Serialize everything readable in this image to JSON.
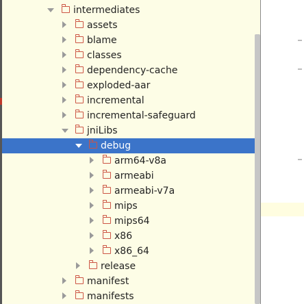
{
  "tree": {
    "items": [
      {
        "label": "intermediates",
        "state": "expanded",
        "depth": 0
      },
      {
        "label": "assets",
        "state": "collapsed",
        "depth": 1
      },
      {
        "label": "blame",
        "state": "collapsed",
        "depth": 1
      },
      {
        "label": "classes",
        "state": "collapsed",
        "depth": 1
      },
      {
        "label": "dependency-cache",
        "state": "collapsed",
        "depth": 1
      },
      {
        "label": "exploded-aar",
        "state": "collapsed",
        "depth": 1
      },
      {
        "label": "incremental",
        "state": "collapsed",
        "depth": 1
      },
      {
        "label": "incremental-safeguard",
        "state": "collapsed",
        "depth": 1
      },
      {
        "label": "jniLibs",
        "state": "expanded",
        "depth": 1
      },
      {
        "label": "debug",
        "state": "expanded",
        "depth": 2,
        "selected": true
      },
      {
        "label": "arm64-v8a",
        "state": "collapsed",
        "depth": 3
      },
      {
        "label": "armeabi",
        "state": "collapsed",
        "depth": 3
      },
      {
        "label": "armeabi-v7a",
        "state": "collapsed",
        "depth": 3
      },
      {
        "label": "mips",
        "state": "collapsed",
        "depth": 3
      },
      {
        "label": "mips64",
        "state": "collapsed",
        "depth": 3
      },
      {
        "label": "x86",
        "state": "collapsed",
        "depth": 3
      },
      {
        "label": "x86_64",
        "state": "collapsed",
        "depth": 3
      },
      {
        "label": "release",
        "state": "collapsed",
        "depth": 2
      },
      {
        "label": "manifest",
        "state": "collapsed",
        "depth": 1
      },
      {
        "label": "manifests",
        "state": "collapsed",
        "depth": 1
      }
    ]
  },
  "colors": {
    "panel_background": "#fdfde6",
    "selection": "#3b74c9",
    "folder_icon": "#cc5544",
    "text": "#222222"
  }
}
